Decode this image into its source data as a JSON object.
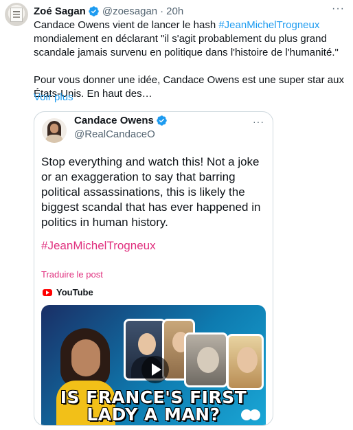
{
  "tweet": {
    "author": {
      "name": "Zoé Sagan",
      "handle": "@zoesagan",
      "separator": "·",
      "time": "20h"
    },
    "more_label": "···",
    "paragraph1_prefix": "Candace Owens vient de lancer le hash ",
    "paragraph1_hashtag": "#JeanMichelTrogneux",
    "paragraph1_suffix": " mondialement en déclarant \"il s'agit probablement du plus grand scandale jamais survenu en politique dans l'histoire de l'humanité.\"",
    "paragraph2": "Pour vous donner une idée, Candace Owens est une super star aux États-Unis. En haut des…",
    "show_more": "Voir plus",
    "accent": "#1d9bf0"
  },
  "quote": {
    "author": {
      "name": "Candace Owens",
      "handle": "@RealCandaceO"
    },
    "more_label": "···",
    "text": "Stop everything and watch this! Not a joke or an exaggeration to say that barring political assassinations, this is likely the biggest scandal that has ever happened in politics in human history.",
    "hashtag": "#JeanMichelTrogneux",
    "translate": "Traduire le post",
    "source": "YouTube",
    "video_headline_line1": "IS FRANCE'S FIRST",
    "video_headline_line2": "LADY A MAN?",
    "pink": "#e0317f"
  },
  "icons": [
    "verified-badge-icon",
    "more-options-icon",
    "youtube-icon",
    "play-icon"
  ]
}
